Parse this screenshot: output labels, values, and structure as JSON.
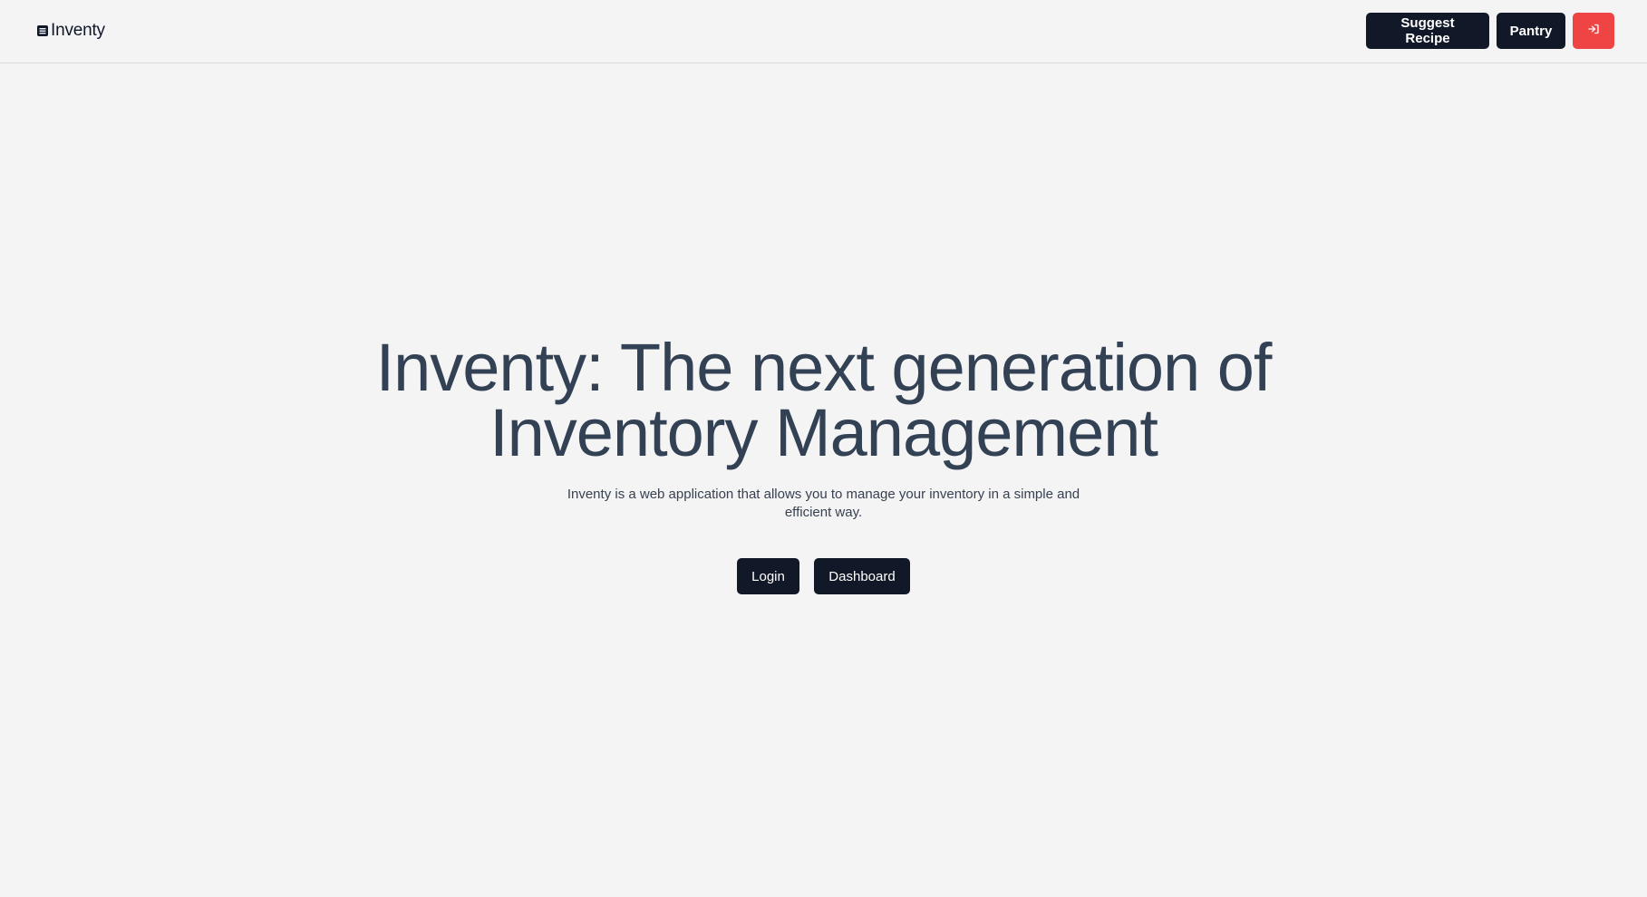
{
  "brand": {
    "name": "Inventy",
    "icon": "document-list-icon"
  },
  "nav": {
    "suggest_label": "Suggest Recipe",
    "pantry_label": "Pantry",
    "logout_icon": "logout-icon",
    "logout_color": "#ef4444"
  },
  "hero": {
    "title": "Inventy: The next generation of Inventory Management",
    "subtitle": "Inventy is a web application that allows you to manage your inventory in a simple and efficient way.",
    "login_label": "Login",
    "dashboard_label": "Dashboard"
  },
  "colors": {
    "background": "#f4f4f4",
    "primary_button": "#111827",
    "title_text": "#334155",
    "danger": "#ef4444"
  }
}
